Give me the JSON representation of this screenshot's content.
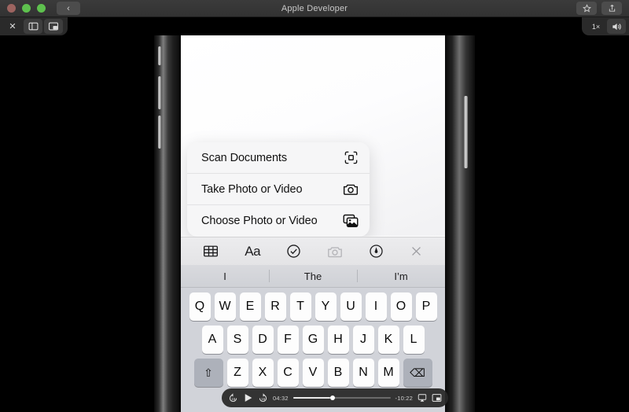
{
  "window": {
    "title": "Apple Developer",
    "traffic_lights": [
      "close",
      "minimize",
      "zoom"
    ],
    "back_label": "‹",
    "star_icon": "star-icon",
    "share_icon": "share-icon"
  },
  "video_toolbar": {
    "close_label": "✕",
    "sidebar_icon": "sidebar-icon",
    "pip_icon": "picture-in-picture-icon",
    "speed_label": "1×",
    "volume_icon": "volume-icon"
  },
  "device": {
    "name": "iphone-frame",
    "buttons": [
      "volume-up",
      "volume-down",
      "ring-silent",
      "power"
    ]
  },
  "action_sheet": {
    "items": [
      {
        "label": "Scan Documents",
        "icon": "document-scanner-icon"
      },
      {
        "label": "Take Photo or Video",
        "icon": "camera-icon"
      },
      {
        "label": "Choose Photo or Video",
        "icon": "photo-library-icon"
      }
    ]
  },
  "format_toolbar": {
    "items": [
      {
        "name": "table-icon",
        "label": ""
      },
      {
        "name": "text-format-icon",
        "label": "Aa"
      },
      {
        "name": "checklist-icon",
        "label": ""
      },
      {
        "name": "camera-icon",
        "label": ""
      },
      {
        "name": "markup-pen-icon",
        "label": ""
      },
      {
        "name": "close-icon",
        "label": ""
      }
    ]
  },
  "keyboard": {
    "predictions": [
      "I",
      "The",
      "I’m"
    ],
    "row1": [
      "Q",
      "W",
      "E",
      "R",
      "T",
      "Y",
      "U",
      "I",
      "O",
      "P"
    ],
    "row2": [
      "A",
      "S",
      "D",
      "F",
      "G",
      "H",
      "J",
      "K",
      "L"
    ],
    "row3": [
      "⇧",
      "Z",
      "X",
      "C",
      "V",
      "B",
      "N",
      "M",
      "⌫"
    ]
  },
  "player": {
    "skip_back_label": "15",
    "play_icon": "play-icon",
    "skip_forward_label": "15",
    "current_time": "04:32",
    "remaining_time": "-10:22",
    "airplay_icon": "airplay-icon",
    "pip_icon": "picture-in-picture-icon"
  }
}
